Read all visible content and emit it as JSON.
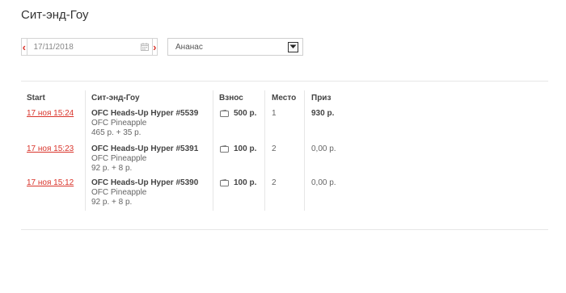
{
  "page": {
    "title": "Сит-энд-Гоу"
  },
  "filters": {
    "date_value": "17/11/2018",
    "prev_label": "‹",
    "next_label": "›",
    "game_selected": "Ананас"
  },
  "table": {
    "headers": {
      "start": "Start",
      "name": "Сит-энд-Гоу",
      "buyin": "Взнос",
      "place": "Место",
      "prize": "Приз"
    },
    "rows": [
      {
        "date": "17 ноя 15:24",
        "name": "OFC Heads-Up Hyper #5539",
        "game": "OFC Pineapple",
        "fee": "465 р. + 35 р.",
        "buyin": "500 р.",
        "place": "1",
        "prize": "930 р."
      },
      {
        "date": "17 ноя 15:23",
        "name": "OFC Heads-Up Hyper #5391",
        "game": "OFC Pineapple",
        "fee": "92 р. + 8 р.",
        "buyin": "100 р.",
        "place": "2",
        "prize": "0,00 р."
      },
      {
        "date": "17 ноя 15:12",
        "name": "OFC Heads-Up Hyper #5390",
        "game": "OFC Pineapple",
        "fee": "92 р. + 8 р.",
        "buyin": "100 р.",
        "place": "2",
        "prize": "0,00 р."
      }
    ]
  },
  "colors": {
    "accent": "#d9342b",
    "border": "#e6e6e6"
  }
}
